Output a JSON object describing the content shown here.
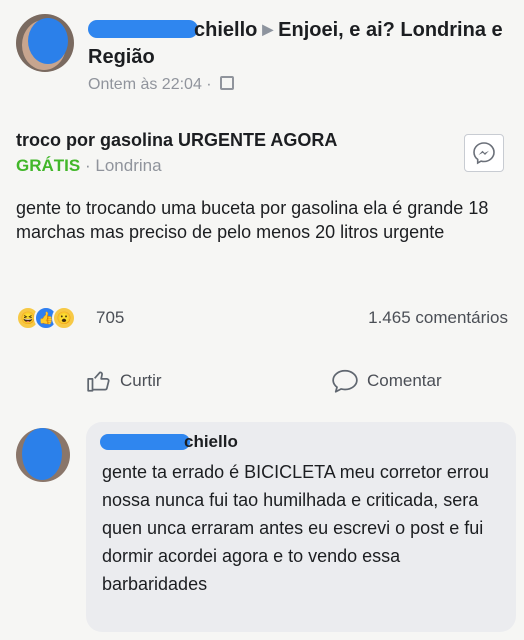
{
  "post": {
    "author_partial": "chiello",
    "group": "Enjoei, e ai? Londrina e Região",
    "timestamp": "Ontem às 22:04",
    "separator": "·"
  },
  "listing": {
    "title": "troco por gasolina URGENTE AGORA",
    "price": "GRÁTIS",
    "location": "Londrina"
  },
  "body": "gente to trocando uma buceta por gasolina ela é grande  18 marchas mas preciso de pelo menos 20 litros urgente",
  "reactions": {
    "count": "705",
    "comments": "1.465 comentários"
  },
  "actions": {
    "like": "Curtir",
    "comment": "Comentar"
  },
  "comment": {
    "author_partial": "chiello",
    "text": "gente ta errado é BICICLETA meu corretor errou nossa nunca fui tao humilhada e criticada, sera quen unca erraram antes  eu escrevi o post e fui dormir acordei agora e to vendo essa barbaridades"
  },
  "colors": {
    "accent_blue": "#2f86ef",
    "free_green": "#42b72a",
    "muted_text": "#90949c"
  }
}
